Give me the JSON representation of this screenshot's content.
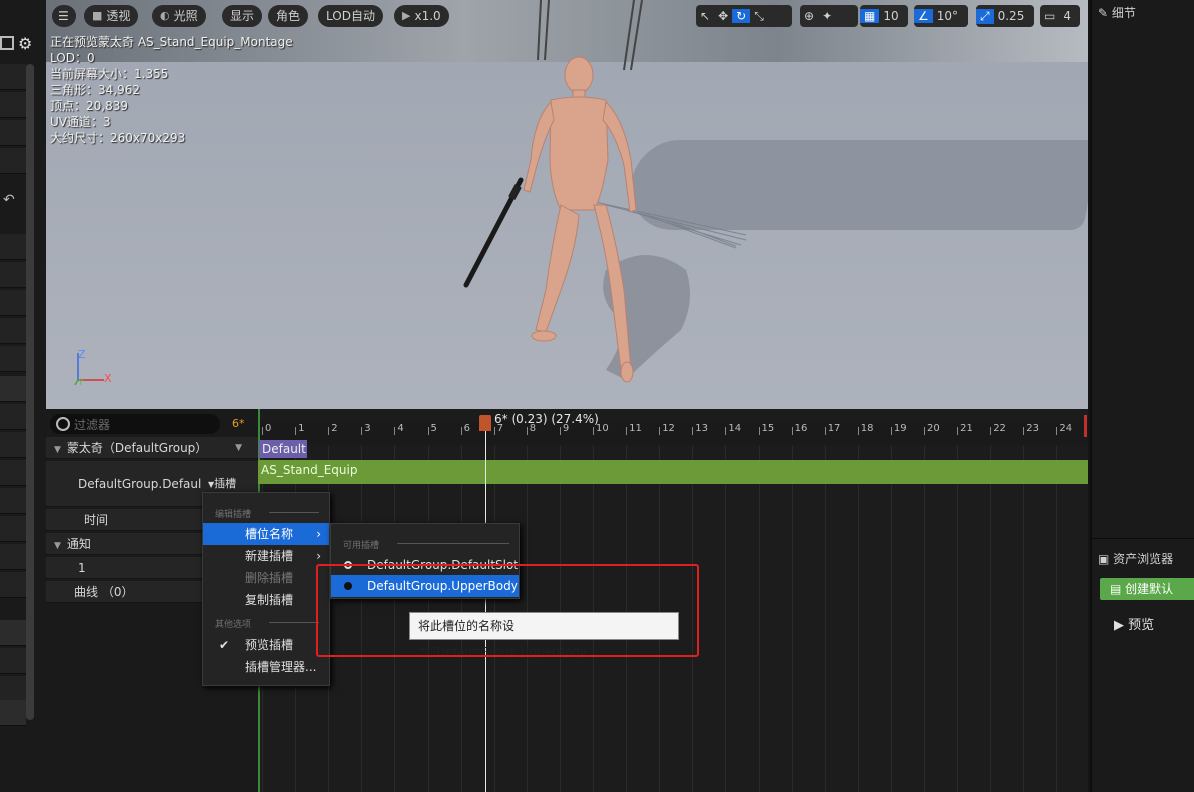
{
  "toolbar": {
    "perspective": "透视",
    "lighting": "光照",
    "show": "显示",
    "character": "角色",
    "lod": "LOD自动",
    "speed": "x1.0",
    "grid_value": "10",
    "angle_value": "10°",
    "scale_value": "0.25",
    "camera_value": "4"
  },
  "viewport_info": [
    "正在预览蒙太奇 AS_Stand_Equip_Montage",
    "LOD：0",
    "当前屏幕大小：1.355",
    "三角形：34,962",
    "顶点：20,839",
    "UV通道：3",
    "大约尺寸：260x70x293"
  ],
  "axis": {
    "z": "Z",
    "x": "X",
    "y": "Y"
  },
  "right_panel": {
    "details": "细节",
    "asset_browser": "资产浏览器",
    "create_default": "创建默认",
    "preview": "预览"
  },
  "tree": {
    "filter_placeholder": "过滤器",
    "frame_tag": "6*",
    "group_row": "蒙太奇（DefaultGroup）",
    "slot_row": "DefaultGroup.Defaul",
    "slot_btn": "插槽",
    "time_row": "时间",
    "notify_row": "通知",
    "notify_track": "1",
    "curve_row": "曲线 （0）"
  },
  "timeline": {
    "ticks": [
      "0",
      "1",
      "2",
      "3",
      "4",
      "5",
      "6",
      "7",
      "8",
      "9",
      "10",
      "11",
      "12",
      "13",
      "14",
      "15",
      "16",
      "17",
      "18",
      "19",
      "20",
      "21",
      "22",
      "23",
      "24"
    ],
    "scrub_label": "6* (0.23) (27.4%)",
    "section_label": "Default",
    "segment_label": "AS_Stand_Equip",
    "scrub_frame": 6.7
  },
  "context_menu": {
    "section_edit": "编辑插槽",
    "slot_name": "槽位名称",
    "new_slot": "新建插槽",
    "delete_slot": "删除插槽",
    "copy_slot": "复制插槽",
    "section_other": "其他选项",
    "preview_slot": "预览插槽",
    "slot_manager": "插槽管理器..."
  },
  "submenu": {
    "header": "可用插槽",
    "items": [
      "DefaultGroup.DefaultSlot",
      "DefaultGroup.UpperBody"
    ]
  },
  "tooltip": "将此槽位的名称设为“DefaultGroup.UpperBody”",
  "colors": {
    "accent": "#1a6ad8",
    "highlight": "#e02020",
    "segment": "#6c9a38"
  }
}
